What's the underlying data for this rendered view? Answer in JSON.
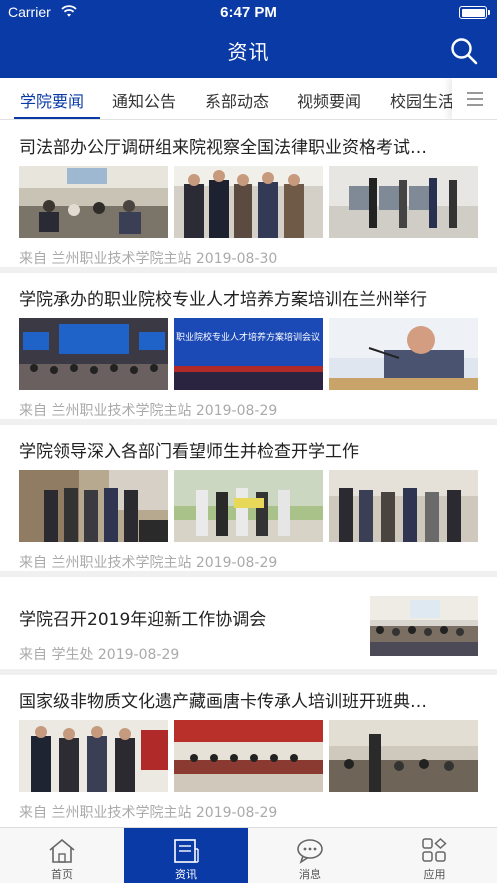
{
  "status_bar": {
    "carrier": "Carrier",
    "time": "6:47 PM"
  },
  "nav": {
    "title": "资讯",
    "search_icon": "search-icon"
  },
  "tabs": [
    {
      "label": "学院要闻",
      "active": true
    },
    {
      "label": "通知公告",
      "active": false
    },
    {
      "label": "系部动态",
      "active": false
    },
    {
      "label": "视频要闻",
      "active": false
    },
    {
      "label": "校园生活",
      "active": false
    }
  ],
  "tab_menu_icon": "menu-icon",
  "news": [
    {
      "title": "司法部办公厅调研组来院视察全国法律职业资格考试…",
      "meta": "来自 兰州职业技术学院主站 2019-08-30"
    },
    {
      "title": "学院承办的职业院校专业人才培养方案培训在兰州举行",
      "meta": "来自 兰州职业技术学院主站 2019-08-29",
      "banner_text": "职业院校专业人才培养方案培训会议"
    },
    {
      "title": "学院领导深入各部门看望师生并检查开学工作",
      "meta": "来自 兰州职业技术学院主站 2019-08-29"
    },
    {
      "title": "学院召开2019年迎新工作协调会",
      "meta": "来自 学生处 2019-08-29"
    },
    {
      "title": "国家级非物质文化遗产藏画唐卡传承人培训班开班典…",
      "meta": "来自 兰州职业技术学院主站 2019-08-29"
    }
  ],
  "bottom_tabs": [
    {
      "label": "首页",
      "icon": "home-icon",
      "active": false
    },
    {
      "label": "资讯",
      "icon": "news-icon",
      "active": true
    },
    {
      "label": "消息",
      "icon": "message-icon",
      "active": false
    },
    {
      "label": "应用",
      "icon": "apps-icon",
      "active": false
    }
  ],
  "colors": {
    "brand": "#0a3aa6",
    "meta_text": "#aaaaaa",
    "title_text": "#222222"
  }
}
